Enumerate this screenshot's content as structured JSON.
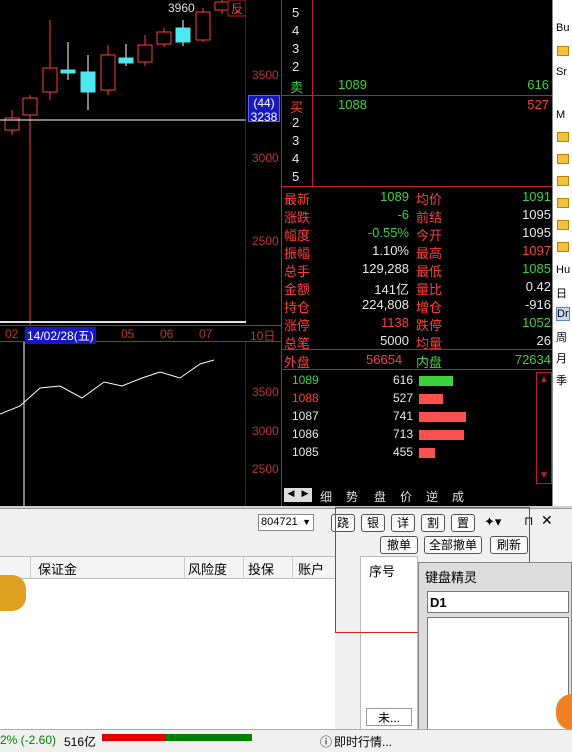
{
  "kline": {
    "high_label": "3960",
    "fan_label": "反",
    "price_ticks": [
      "3500",
      "3000",
      "2500"
    ],
    "marker_change": "(44)",
    "marker_price": "3238"
  },
  "datebar": {
    "labels": [
      "02",
      "05",
      "06",
      "07",
      "10日"
    ],
    "highlight": "14/02/28(五)"
  },
  "sub_ticks": [
    "3500",
    "3000",
    "2500"
  ],
  "orderbook": {
    "sell_levels": [
      "5",
      "4",
      "3",
      "2"
    ],
    "sell1_label": "卖",
    "sell1_price": "1089",
    "sell1_vol": "616",
    "buy1_label": "买",
    "buy1_price": "1088",
    "buy1_vol": "527",
    "buy_levels": [
      "2",
      "3",
      "4",
      "5"
    ]
  },
  "stats": [
    {
      "l": "最新",
      "v": "1089",
      "vc": "green",
      "l2": "均价",
      "v2": "1091",
      "v2c": "green"
    },
    {
      "l": "涨跌",
      "v": "-6",
      "vc": "green",
      "l2": "前结",
      "v2": "1095",
      "v2c": "white"
    },
    {
      "l": "幅度",
      "v": "-0.55%",
      "vc": "green",
      "l2": "今开",
      "v2": "1095",
      "v2c": "white"
    },
    {
      "l": "振幅",
      "v": "1.10%",
      "vc": "white",
      "l2": "最高",
      "v2": "1097",
      "v2c": "red"
    },
    {
      "l": "总手",
      "v": "129,288",
      "vc": "white",
      "l2": "最低",
      "v2": "1085",
      "v2c": "green"
    },
    {
      "l": "金额",
      "v": "141亿",
      "vc": "white",
      "l2": "量比",
      "v2": "0.42",
      "v2c": "white"
    },
    {
      "l": "持仓",
      "v": "224,808",
      "vc": "white",
      "l2": "增仓",
      "v2": "-916",
      "v2c": "white"
    },
    {
      "l": "涨停",
      "v": "1138",
      "vc": "red",
      "l2": "跌停",
      "v2": "1052",
      "v2c": "green"
    },
    {
      "l": "总笔",
      "v": "5000",
      "vc": "white",
      "l2": "均量",
      "v2": "26",
      "v2c": "white"
    }
  ],
  "outer": {
    "label": "外盘",
    "value": "56654",
    "label2": "内盘",
    "value2": "72634"
  },
  "depth": [
    {
      "price": "1089",
      "vol": "616",
      "pc": "green",
      "frac": 0.72,
      "bc": "#3cd23c"
    },
    {
      "price": "1088",
      "vol": "527",
      "pc": "red",
      "frac": 0.52,
      "bc": "#ff5050"
    },
    {
      "price": "1087",
      "vol": "741",
      "pc": "white",
      "frac": 1.0,
      "bc": "#ff5050"
    },
    {
      "price": "1086",
      "vol": "713",
      "pc": "white",
      "frac": 0.95,
      "bc": "#ff5050"
    },
    {
      "price": "1085",
      "vol": "455",
      "pc": "white",
      "frac": 0.35,
      "bc": "#ff5050"
    }
  ],
  "quote_tabs": [
    "细",
    "势",
    "盘",
    "价",
    "逆",
    "成"
  ],
  "right_strip": [
    "Bu",
    "Sr",
    "M",
    "Hu",
    "日",
    "Dr",
    "周",
    "月",
    "季"
  ],
  "toolbar": {
    "account": "804721",
    "icons": [
      "跷",
      "银",
      "详",
      "割",
      "置"
    ],
    "cancel": "撤单",
    "cancel_all": "全部撤单",
    "refresh": "刷新"
  },
  "table_headers": [
    "保证金",
    "风险度",
    "投保",
    "账户"
  ],
  "order_header": "序号",
  "unfinished_tab": "未...",
  "dialog": {
    "title": "键盘精灵",
    "input": "D1"
  },
  "status": {
    "change": "2% (-2.60)",
    "amount": "516亿",
    "news": "即时行情..."
  }
}
